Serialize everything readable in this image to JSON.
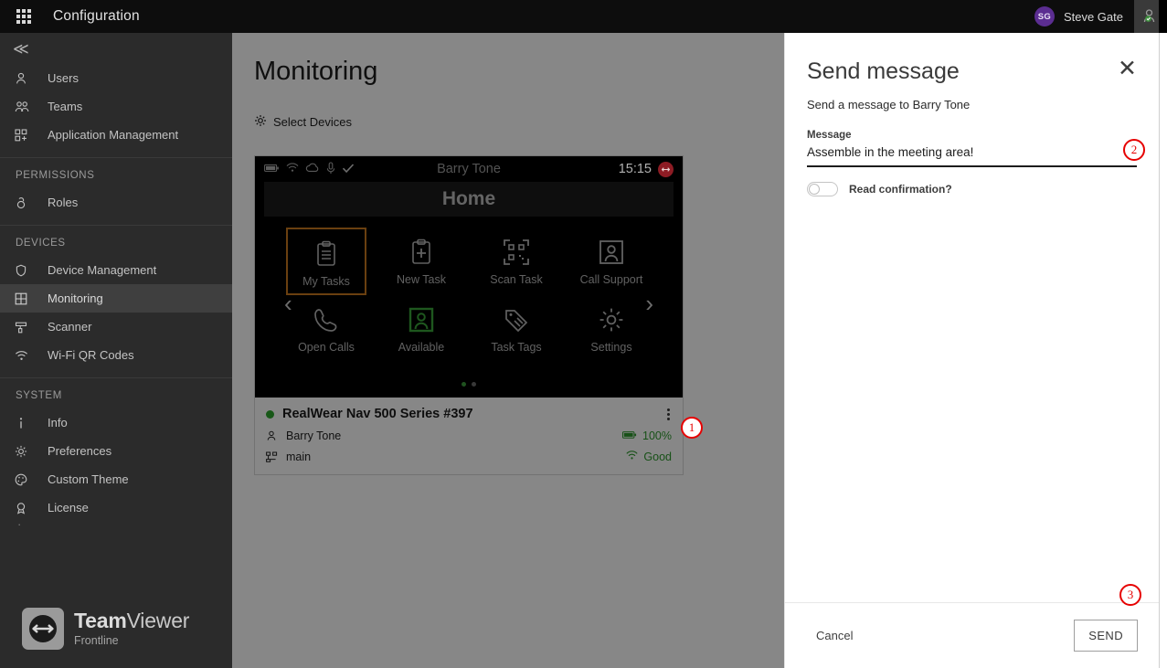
{
  "topbar": {
    "apps_icon": "apps-grid-icon",
    "title": "Configuration",
    "user_initials": "SG",
    "user_name": "Steve Gate",
    "assist_icon": "remote-assist-icon"
  },
  "sidebar": {
    "collapse_icon": "chevron-double-left-icon",
    "items": [
      {
        "label": "Users",
        "icon": "user-icon",
        "active": false
      },
      {
        "label": "Teams",
        "icon": "users-group-icon",
        "active": false
      },
      {
        "label": "Application Management",
        "icon": "app-add-icon",
        "active": false
      }
    ],
    "groups": [
      {
        "title": "PERMISSIONS",
        "items": [
          {
            "label": "Roles",
            "icon": "lock-icon",
            "active": false
          }
        ]
      },
      {
        "title": "DEVICES",
        "items": [
          {
            "label": "Device Management",
            "icon": "shield-icon",
            "active": false
          },
          {
            "label": "Monitoring",
            "icon": "grid-square-icon",
            "active": true
          },
          {
            "label": "Scanner",
            "icon": "scanner-icon",
            "active": false
          },
          {
            "label": "Wi-Fi QR Codes",
            "icon": "wifi-icon",
            "active": false
          }
        ]
      },
      {
        "title": "SYSTEM",
        "items": [
          {
            "label": "Info",
            "icon": "info-icon",
            "active": false
          },
          {
            "label": "Preferences",
            "icon": "gear-icon",
            "active": false
          },
          {
            "label": "Custom Theme",
            "icon": "palette-icon",
            "active": false
          },
          {
            "label": "License",
            "icon": "license-icon",
            "active": false
          }
        ]
      }
    ],
    "brand": {
      "name_bold": "Team",
      "name_light": "Viewer",
      "subtitle": "Frontline",
      "logo_icon": "teamviewer-logo-icon"
    }
  },
  "main": {
    "page_title": "Monitoring",
    "select_devices": {
      "label": "Select Devices",
      "icon": "gear-icon"
    },
    "device_preview": {
      "status_icons": [
        "battery-icon",
        "wifi-icon",
        "cloud-icon",
        "microphone-icon",
        "check-icon"
      ],
      "user": "Barry Tone",
      "time": "15:15",
      "badge_icon": "teamviewer-logo-icon",
      "screen_title": "Home",
      "tiles_row1": [
        {
          "label": "My Tasks",
          "icon": "clipboard-list-icon",
          "highlight": "orange"
        },
        {
          "label": "New Task",
          "icon": "clipboard-plus-icon",
          "highlight": "none"
        },
        {
          "label": "Scan Task",
          "icon": "qr-scan-icon",
          "highlight": "none"
        },
        {
          "label": "Call Support",
          "icon": "person-frame-icon",
          "highlight": "none"
        }
      ],
      "tiles_row2": [
        {
          "label": "Open Calls",
          "icon": "phone-icon",
          "highlight": "none"
        },
        {
          "label": "Available",
          "icon": "person-frame-icon",
          "highlight": "green"
        },
        {
          "label": "Task Tags",
          "icon": "tag-icon",
          "highlight": "none"
        },
        {
          "label": "Settings",
          "icon": "gear-icon",
          "highlight": "none"
        }
      ],
      "prev_arrow": "chevron-left-icon",
      "next_arrow": "chevron-right-icon",
      "page_dots": 2,
      "active_dot": 1
    },
    "device_card": {
      "status": "online",
      "name": "RealWear Nav 500 Series #397",
      "menu_icon": "kebab-menu-icon",
      "user": {
        "label": "Barry Tone",
        "icon": "user-icon"
      },
      "network": {
        "label": "main",
        "icon": "network-icon"
      },
      "battery": {
        "label": "100%",
        "icon": "battery-icon"
      },
      "signal": {
        "label": "Good",
        "icon": "wifi-icon"
      }
    }
  },
  "panel": {
    "title": "Send message",
    "close_icon": "close-icon",
    "subtitle": "Send a message to Barry Tone",
    "field_label": "Message",
    "field_value": "Assemble in the meeting area!",
    "field_placeholder": "Message",
    "toggle_label": "Read confirmation?",
    "toggle_state": "off",
    "cancel_label": "Cancel",
    "send_label": "SEND"
  },
  "annotations": [
    {
      "number": "1"
    },
    {
      "number": "2"
    },
    {
      "number": "3"
    }
  ],
  "colors": {
    "accent_red": "#e60000",
    "online_green": "#2fa62f",
    "avatar_purple": "#5b2d91",
    "highlight_orange": "#c8791f"
  }
}
